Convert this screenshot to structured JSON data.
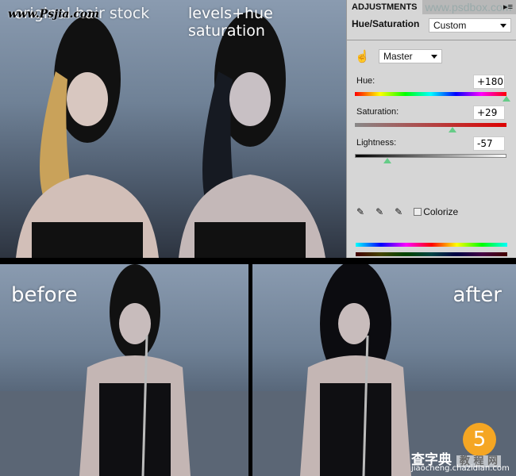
{
  "captions": {
    "original": "original hair stock",
    "watermark_top": "www.Psjia.com",
    "levels": "levels+hue saturation",
    "before": "before",
    "after": "after"
  },
  "panel": {
    "tab": "ADJUSTMENTS",
    "tab_watermark": "www.psdbox.com",
    "title": "Hue/Saturation",
    "preset": "Custom",
    "channel": "Master",
    "hue": {
      "label": "Hue:",
      "value": "+180",
      "fraction": 1.0
    },
    "saturation": {
      "label": "Saturation:",
      "value": "+29",
      "fraction": 0.645
    },
    "lightness": {
      "label": "Lightness:",
      "value": "-57",
      "fraction": 0.215
    },
    "colorize_label": "Colorize",
    "colorize_checked": false
  },
  "badge": {
    "step": "5",
    "color": "#f5a623"
  },
  "footer_watermark": {
    "brand": "查字典",
    "sub": "教 程 网",
    "url": "jiaocheng.chazidian.com"
  }
}
